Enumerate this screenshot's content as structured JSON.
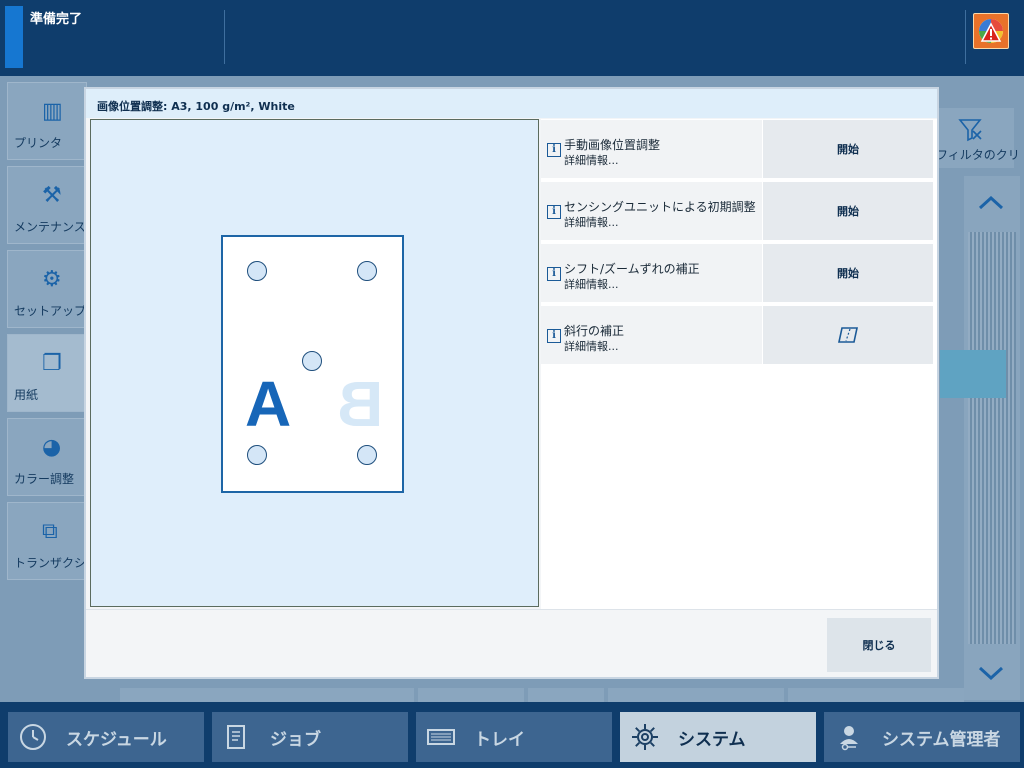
{
  "status": {
    "text": "準備完了"
  },
  "sidebar": {
    "items": [
      {
        "label": "プリンタ",
        "icon": "printer-icon"
      },
      {
        "label": "メンテナンス",
        "icon": "maintenance-icon"
      },
      {
        "label": "セットアップ",
        "icon": "setup-icon"
      },
      {
        "label": "用紙",
        "icon": "paper-icon",
        "selected": true
      },
      {
        "label": "カラー調整",
        "icon": "color-icon"
      },
      {
        "label": "トランザクション",
        "icon": "transaction-icon"
      }
    ]
  },
  "right_panel": {
    "label": "フィルタのクリア"
  },
  "dialog": {
    "title": "画像位置調整: A3, 100 g/m², White",
    "preview": {
      "letter_a": "A",
      "letter_b": "B"
    },
    "actions": [
      {
        "title": "手動画像位置調整",
        "detail": "詳細情報...",
        "button": "開始"
      },
      {
        "title": "センシングユニットによる初期調整",
        "detail": "詳細情報...",
        "button": "開始"
      },
      {
        "title": "シフト/ズームずれの補正",
        "detail": "詳細情報...",
        "button": "開始"
      },
      {
        "title": "斜行の補正",
        "detail": "詳細情報...",
        "button": ""
      }
    ],
    "info_glyph": "i",
    "close_label": "閉じる"
  },
  "navbar": {
    "tabs": [
      {
        "label": "スケジュール",
        "icon": "clock-icon"
      },
      {
        "label": "ジョブ",
        "icon": "document-icon"
      },
      {
        "label": "トレイ",
        "icon": "tray-icon"
      },
      {
        "label": "システム",
        "icon": "gear-icon",
        "active": true
      },
      {
        "label": "システム管理者",
        "icon": "admin-icon"
      }
    ]
  },
  "colors": {
    "accent": "#1677d1",
    "nav_bg": "#0f3d6c",
    "alert": "#e8722a"
  }
}
